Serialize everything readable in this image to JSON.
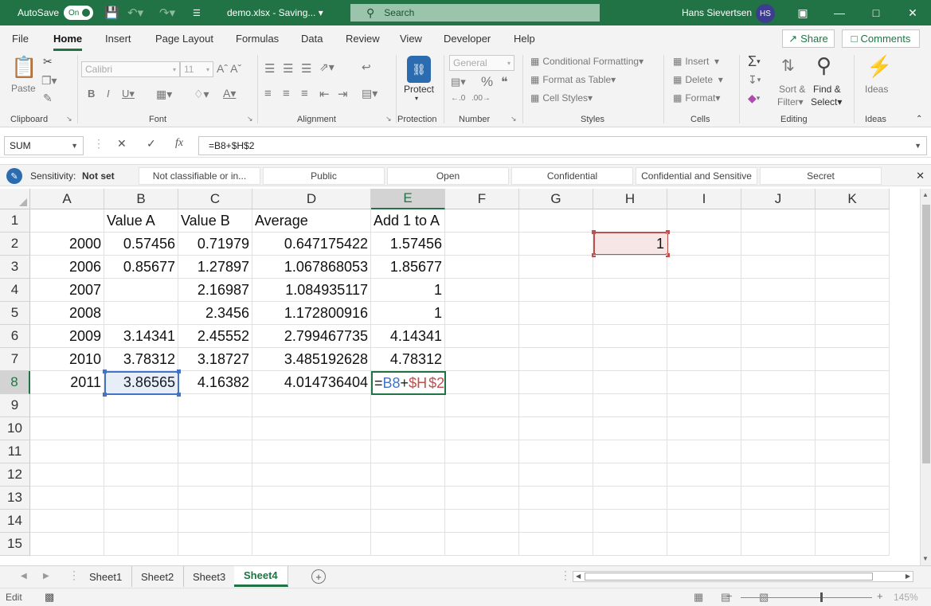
{
  "titlebar": {
    "autosave_label": "AutoSave",
    "autosave_state": "On",
    "document": "demo.xlsx - Saving... ▾",
    "search_placeholder": "Search",
    "user_name": "Hans Sievertsen",
    "user_initials": "HS"
  },
  "tabs": [
    "File",
    "Home",
    "Insert",
    "Page Layout",
    "Formulas",
    "Data",
    "Review",
    "View",
    "Developer",
    "Help"
  ],
  "active_tab": "Home",
  "share_label": "Share",
  "comments_label": "Comments",
  "ribbon": {
    "paste_label": "Paste",
    "font_name": "Calibri",
    "font_size": "11",
    "number_format": "General",
    "protect_label": "Protect",
    "conditional_formatting": "Conditional Formatting",
    "format_as_table": "Format as Table",
    "cell_styles": "Cell Styles",
    "insert": "Insert",
    "delete": "Delete",
    "format": "Format",
    "sort_filter": "Sort &",
    "sort_filter_2": "Filter",
    "find_select": "Find &",
    "find_select_2": "Select",
    "ideas": "Ideas",
    "groups": [
      "Clipboard",
      "Font",
      "Alignment",
      "Protection",
      "Number",
      "Styles",
      "Cells",
      "Editing",
      "Ideas"
    ]
  },
  "formula_bar": {
    "name_box": "SUM",
    "formula": "=B8+$H$2"
  },
  "sensitivity": {
    "label": "Sensitivity:",
    "value": "Not set",
    "options": [
      "Not classifiable or in...",
      "Public",
      "Open",
      "Confidential",
      "Confidential and Sensitive",
      "Secret"
    ]
  },
  "grid": {
    "columns": [
      "A",
      "B",
      "C",
      "D",
      "E",
      "F",
      "G",
      "H",
      "I",
      "J",
      "K"
    ],
    "rows": [
      "1",
      "2",
      "3",
      "4",
      "5",
      "6",
      "7",
      "8",
      "9",
      "10",
      "11",
      "12",
      "13",
      "14",
      "15"
    ],
    "row1": [
      "",
      "Value A",
      "Value B",
      "Average",
      "Add 1 to A"
    ],
    "row2": [
      "2000",
      "0.57456",
      "0.71979",
      "0.647175422",
      "1.57456"
    ],
    "row3": [
      "2006",
      "0.85677",
      "1.27897",
      "1.067868053",
      "1.85677"
    ],
    "row4": [
      "2007",
      "",
      "2.16987",
      "1.084935117",
      "1"
    ],
    "row5": [
      "2008",
      "",
      "2.3456",
      "1.172800916",
      "1"
    ],
    "row6": [
      "2009",
      "3.14341",
      "2.45552",
      "2.799467735",
      "4.14341"
    ],
    "row7": [
      "2010",
      "3.78312",
      "3.18727",
      "3.485192628",
      "4.78312"
    ],
    "row8": [
      "2011",
      "3.86565",
      "4.16382",
      "4.014736404"
    ],
    "h2": "1",
    "edit_cell": {
      "prefix": "=",
      "ref1": "B8",
      "op": "+",
      "ref2a": "$H",
      "ref2b": "$2"
    }
  },
  "sheets": [
    "Sheet1",
    "Sheet2",
    "Sheet3",
    "Sheet4"
  ],
  "active_sheet": "Sheet4",
  "status": {
    "mode": "Edit",
    "zoom": "145%"
  }
}
